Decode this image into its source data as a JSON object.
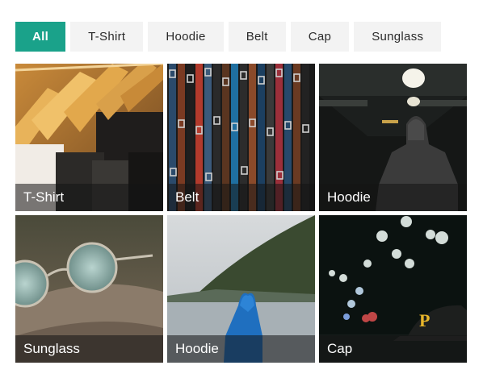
{
  "filters": [
    {
      "label": "All",
      "active": true
    },
    {
      "label": "T-Shirt",
      "active": false
    },
    {
      "label": "Hoodie",
      "active": false
    },
    {
      "label": "Belt",
      "active": false
    },
    {
      "label": "Cap",
      "active": false
    },
    {
      "label": "Sunglass",
      "active": false
    }
  ],
  "gallery": [
    {
      "caption": "T-Shirt",
      "image": "clothes-on-hangers"
    },
    {
      "caption": "Belt",
      "image": "hanging-belts"
    },
    {
      "caption": "Hoodie",
      "image": "hooded-person-in-tunnel"
    },
    {
      "caption": "Sunglass",
      "image": "round-sunglasses-on-rock"
    },
    {
      "caption": "Hoodie",
      "image": "person-in-blue-hoodie-by-lake"
    },
    {
      "caption": "Cap",
      "image": "cap-with-bokeh-lights"
    }
  ],
  "colors": {
    "accent": "#1aa28a",
    "filter_bg": "#f3f3f3"
  }
}
